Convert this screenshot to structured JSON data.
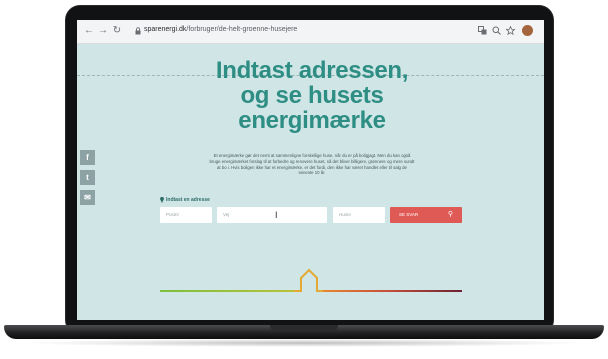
{
  "browser": {
    "url_domain": "sparenergi.dk",
    "url_path": "/forbruger/de-helt-groenne-husejere",
    "nav_back": "←",
    "nav_forward": "→",
    "nav_reload": "↻"
  },
  "hero": {
    "headline_1": "Indtast adressen,",
    "headline_2": "og se husets",
    "headline_3": "energimærke",
    "intro": "Et energimærke gør det nemt at sammenligne forskellige huse, når du er på boligjagt. Men du kan også bruge energimærket forslag til at forbedre og renovere huset, så det bliver billigere, grønnere og mere sundt at bo i. Hvis boligen ikke har et energimærke, er det fordi, den ikke har været handlet eller til salg de seneste 10 år."
  },
  "social": {
    "facebook": "f",
    "twitter": "t",
    "mail": "✉"
  },
  "form": {
    "label": "Indtast en adresse",
    "postnr_placeholder": "Postnr",
    "vej_placeholder": "Vej",
    "husnr_placeholder": "Husnr",
    "submit_label": "SE SVAR"
  },
  "colors": {
    "headline": "#2e8e84",
    "background": "#cfe5e6",
    "button": "#e05a55"
  }
}
